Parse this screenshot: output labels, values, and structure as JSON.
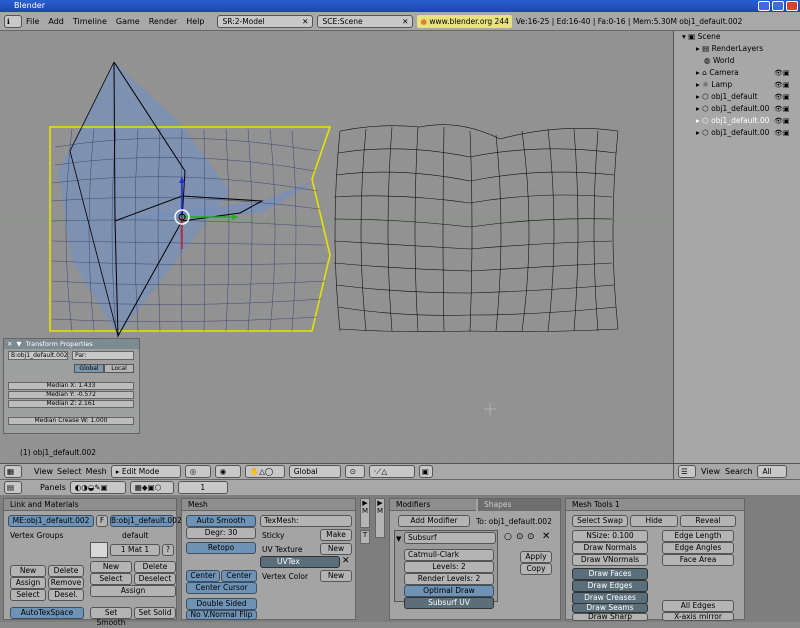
{
  "window": {
    "title": "Blender"
  },
  "topbar": {
    "menus": [
      "File",
      "Add",
      "Timeline",
      "Game",
      "Render",
      "Help"
    ],
    "screen": "SR:2-Model",
    "scene": "SCE:Scene",
    "url": "www.blender.org 244",
    "stats": "Ve:16-25 | Ed:16-40 | Fa:0-16 | Mem:5.30M obj1_default.002"
  },
  "outliner": {
    "items": [
      "Scene",
      "RenderLayers",
      "World",
      "Camera",
      "Lamp",
      "obj1_default",
      "obj1_default.00",
      "obj1_default.00",
      "obj1_default.00"
    ]
  },
  "transform": {
    "title": "Transform Properties",
    "object": "B:obj1_default.002",
    "parent": "Par:",
    "global": "Global",
    "local": "Local",
    "median_x": "Median X: 1.433",
    "median_y": "Median Y: -0.572",
    "median_z": "Median Z: 2.161",
    "crease": "Median Crease W: 1.000"
  },
  "viewport": {
    "object_label": "(1) obj1_default.002"
  },
  "view3d_header": {
    "view": "View",
    "select": "Select",
    "mesh": "Mesh",
    "mode": "Edit Mode",
    "orientation": "Global"
  },
  "outliner_header": {
    "view": "View",
    "search": "Search",
    "scene": "All Sc"
  },
  "buttons_header": {
    "panels": "Panels",
    "frame": "1"
  },
  "link_materials": {
    "title": "Link and Materials",
    "mesh": "ME:obj1_default.002",
    "f": "F",
    "ob": "B:obj1_default.002",
    "vertex_groups": "Vertex Groups",
    "default": "default",
    "mat": "1 Mat 1",
    "q": "?",
    "new1": "New",
    "delete1": "Delete",
    "assign1": "Assign",
    "remove": "Remove",
    "select1": "Select",
    "desel": "Desel.",
    "new2": "New",
    "delete2": "Delete",
    "select2": "Select",
    "deselect": "Deselect",
    "assign2": "Assign",
    "autotex": "AutoTexSpace",
    "setsmooth": "Set Smooth",
    "setsolid": "Set Solid"
  },
  "mesh": {
    "title": "Mesh",
    "autosmooth": "Auto Smooth",
    "degr": "Degr: 30",
    "retopo": "Retopo",
    "center": "Center",
    "centernew": "Center New",
    "centercursor": "Center Cursor",
    "doublesided": "Double Sided",
    "novnormal": "No V.Normal Flip",
    "texmesh": "TexMesh:",
    "sticky": "Sticky",
    "make": "Make",
    "uvtexture": "UV Texture",
    "new1": "New",
    "uvtex": "UVTex",
    "vertexcolor": "Vertex Color",
    "new2": "New"
  },
  "tabs": {
    "m": "M",
    "t": "T"
  },
  "modifiers": {
    "title": "Modifiers",
    "shapes": "Shapes",
    "add": "Add Modifier",
    "to": "To: obj1_default.002",
    "name": "Subsurf",
    "type": "Catmull-Clark",
    "levels": "Levels: 2",
    "render_levels": "Render Levels: 2",
    "optimal": "Optimal Draw",
    "subsurfuv": "Subsurf UV",
    "apply": "Apply",
    "copy": "Copy"
  },
  "meshtools": {
    "title": "Mesh Tools 1",
    "selectswap": "Select Swap",
    "hide": "Hide",
    "reveal": "Reveal",
    "nsize": "NSize: 0.100",
    "drawnormals": "Draw Normals",
    "drawvnormals": "Draw VNormals",
    "edgelength": "Edge Length",
    "edgeangles": "Edge Angles",
    "facearea": "Face Area",
    "drawfaces": "Draw Faces",
    "drawedges": "Draw Edges",
    "drawcreases": "Draw Creases",
    "drawseams": "Draw Seams",
    "drawsharp": "Draw Sharp",
    "alledges": "All Edges",
    "xmirror": "X-axis mirror"
  }
}
